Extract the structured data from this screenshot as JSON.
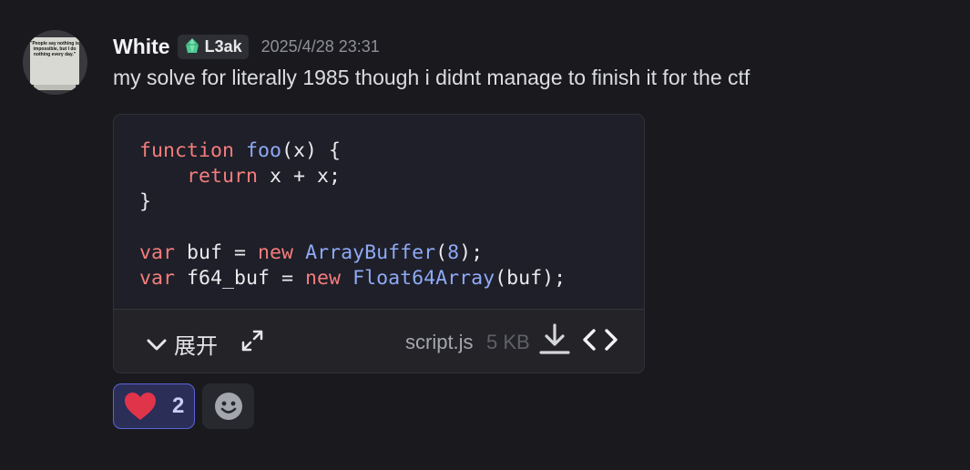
{
  "author": {
    "name": "White",
    "tag": "L3ak",
    "timestamp": "2025/4/28 23:31",
    "avatar_quote": "\"People say nothing is impossible, but I do nothing every day.\""
  },
  "message": {
    "text": "my solve for literally 1985 though i didnt manage to finish it for the ctf"
  },
  "attachment": {
    "code_lines": [
      "function foo(x) {",
      "    return x + x;",
      "}",
      "",
      "var buf = new ArrayBuffer(8);",
      "var f64_buf = new Float64Array(buf);"
    ],
    "expand_label": "展开",
    "filename": "script.js",
    "filesize": "5 KB"
  },
  "reactions": [
    {
      "emoji": "heart",
      "count": "2",
      "active": true
    }
  ],
  "colors": {
    "background": "#1a1a1e",
    "code_keyword": "#f47c7c",
    "code_function": "#8ea9f5",
    "reaction_active_border": "#5b64d9"
  }
}
